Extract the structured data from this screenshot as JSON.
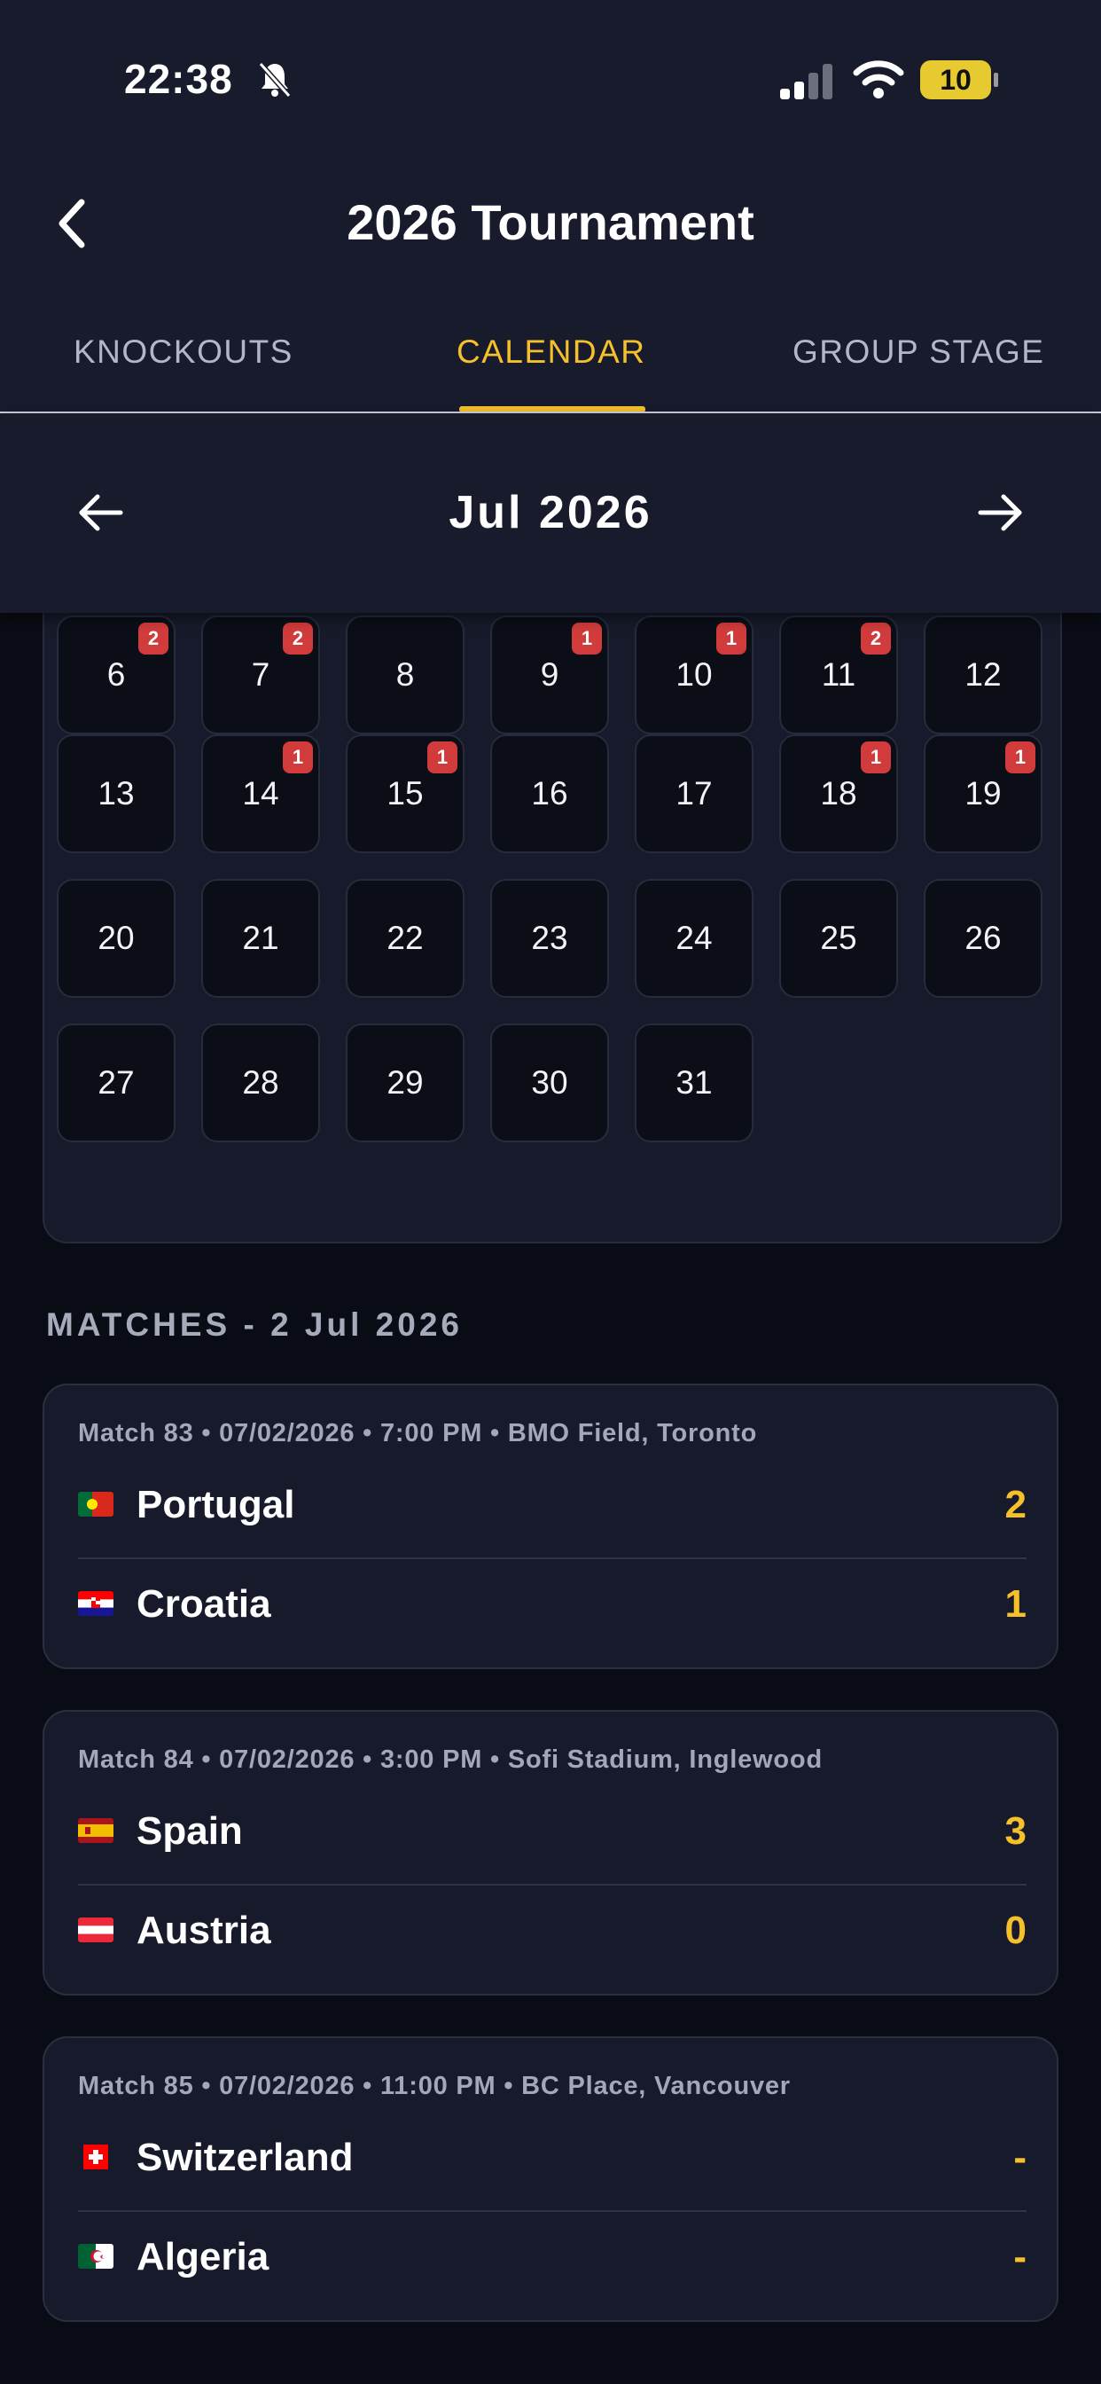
{
  "status_bar": {
    "time": "22:38",
    "battery": "10",
    "icons": [
      "bell-slash-icon",
      "cellular-signal-icon",
      "wifi-icon",
      "battery-icon"
    ]
  },
  "header": {
    "title": "2026 Tournament",
    "back_icon": "chevron-left-icon"
  },
  "tabs": [
    {
      "label": "KNOCKOUTS",
      "active": false
    },
    {
      "label": "CALENDAR",
      "active": true
    },
    {
      "label": "GROUP STAGE",
      "active": false
    }
  ],
  "calendar": {
    "month_label": "Jul 2026",
    "prev_icon": "arrow-left-icon",
    "next_icon": "arrow-right-icon",
    "days": [
      {
        "day": "6",
        "badge": "2"
      },
      {
        "day": "7",
        "badge": "2"
      },
      {
        "day": "8",
        "badge": ""
      },
      {
        "day": "9",
        "badge": "1"
      },
      {
        "day": "10",
        "badge": "1"
      },
      {
        "day": "11",
        "badge": "2"
      },
      {
        "day": "12",
        "badge": ""
      },
      {
        "day": "13",
        "badge": ""
      },
      {
        "day": "14",
        "badge": "1"
      },
      {
        "day": "15",
        "badge": "1"
      },
      {
        "day": "16",
        "badge": ""
      },
      {
        "day": "17",
        "badge": ""
      },
      {
        "day": "18",
        "badge": "1"
      },
      {
        "day": "19",
        "badge": "1"
      },
      {
        "day": "20",
        "badge": ""
      },
      {
        "day": "21",
        "badge": ""
      },
      {
        "day": "22",
        "badge": ""
      },
      {
        "day": "23",
        "badge": ""
      },
      {
        "day": "24",
        "badge": ""
      },
      {
        "day": "25",
        "badge": ""
      },
      {
        "day": "26",
        "badge": ""
      },
      {
        "day": "27",
        "badge": ""
      },
      {
        "day": "28",
        "badge": ""
      },
      {
        "day": "29",
        "badge": ""
      },
      {
        "day": "30",
        "badge": ""
      },
      {
        "day": "31",
        "badge": ""
      }
    ]
  },
  "matches_section": {
    "heading": "MATCHES - 2 Jul 2026",
    "matches": [
      {
        "meta": "Match 83 • 07/02/2026 • 7:00 PM • BMO Field, Toronto",
        "home": {
          "name": "Portugal",
          "score": "2",
          "flag": "portugal-flag-icon"
        },
        "away": {
          "name": "Croatia",
          "score": "1",
          "flag": "croatia-flag-icon"
        }
      },
      {
        "meta": "Match 84 • 07/02/2026 • 3:00 PM • Sofi Stadium, Inglewood",
        "home": {
          "name": "Spain",
          "score": "3",
          "flag": "spain-flag-icon"
        },
        "away": {
          "name": "Austria",
          "score": "0",
          "flag": "austria-flag-icon"
        }
      },
      {
        "meta": "Match 85 • 07/02/2026 • 11:00 PM • BC Place, Vancouver",
        "home": {
          "name": "Switzerland",
          "score": "-",
          "flag": "switzerland-flag-icon"
        },
        "away": {
          "name": "Algeria",
          "score": "-",
          "flag": "algeria-flag-icon"
        }
      }
    ]
  },
  "colors": {
    "background": "#090c14",
    "header": "#171b2c",
    "accent": "#f5c02b",
    "badge": "#d23b3b",
    "card": "#161a2a"
  }
}
